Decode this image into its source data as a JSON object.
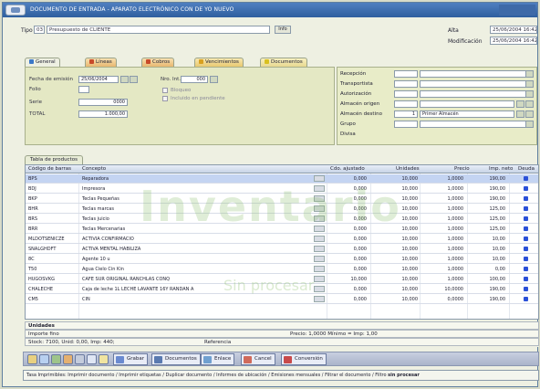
{
  "window": {
    "title": "DOCUMENTO DE ENTRADA - APARATO ELECTRÓNICO CON DE YO NUEVO"
  },
  "header": {
    "tipo_label": "Tipo",
    "tipo_code": "03",
    "tipo_value": "Presupuesto de CLIENTE",
    "info_button": "Info",
    "alta_label": "Alta",
    "alta_value": "25/06/2004 16:42",
    "modificacion_label": "Modificación",
    "modificacion_value": "25/06/2004 16:42"
  },
  "tabs": [
    {
      "label": "General",
      "color": "#3c78c8"
    },
    {
      "label": "Líneas",
      "color": "#c84a2a"
    },
    {
      "label": "Cobros",
      "color": "#c84a2a"
    },
    {
      "label": "Vencimientos",
      "color": "#d8a020"
    },
    {
      "label": "Documentos",
      "color": "#d8c020"
    }
  ],
  "general": {
    "fecha_label": "Fecha de emisión",
    "fecha_value": "25/06/2004",
    "folio_label": "Folio",
    "serie_label": "Serie",
    "serie_value": "0000",
    "total_label": "TOTAL",
    "total_value": "1.000,00",
    "num_label": "Nro. Int.",
    "num_value": "000",
    "check1_label": "Bloqueo",
    "check2_label": "Incluido en pendiente"
  },
  "right_panel": [
    {
      "label": "Recepción",
      "code": "",
      "value": ""
    },
    {
      "label": "Transportista",
      "code": "",
      "value": ""
    },
    {
      "label": "Autorización",
      "code": "",
      "value": ""
    },
    {
      "label": "Almacén origen",
      "code": "",
      "value": ""
    },
    {
      "label": "Almacén destino",
      "code": "1",
      "value": "Primer Almacén"
    },
    {
      "label": "Grupo",
      "code": "",
      "value": ""
    },
    {
      "label": "Divisa",
      "code": "",
      "value": ""
    }
  ],
  "grid": {
    "tab_label": "Tabla de productos",
    "columns": [
      "Código de barras",
      "Concepto",
      "Cdo. ajustado",
      "Unidades",
      "Precio",
      "Imp. neto",
      "Deuda"
    ],
    "rows": [
      {
        "code": "BPS",
        "concept": "Reparadora",
        "cdo": "0,000",
        "units": "10,000",
        "price": "1,0000",
        "neto": "190,00"
      },
      {
        "code": "BDJ",
        "concept": "Impresora",
        "cdo": "0,000",
        "units": "10,000",
        "price": "1,0000",
        "neto": "190,00"
      },
      {
        "code": "BKP",
        "concept": "Teclas Pequeñas",
        "cdo": "0,000",
        "units": "10,000",
        "price": "1,0000",
        "neto": "190,00"
      },
      {
        "code": "BHR",
        "concept": "Teclas marcas",
        "cdo": "0,000",
        "units": "10,000",
        "price": "1,0000",
        "neto": "125,00"
      },
      {
        "code": "BRS",
        "concept": "Teclas juicio",
        "cdo": "0,000",
        "units": "10,000",
        "price": "1,0000",
        "neto": "125,00"
      },
      {
        "code": "BRR",
        "concept": "Teclas Mercenarias",
        "cdo": "0,000",
        "units": "10,000",
        "price": "1,0000",
        "neto": "125,00"
      },
      {
        "code": "MLDOTSENICZE",
        "concept": "ACTIVIA CONFIRMACIÓ",
        "cdo": "0,000",
        "units": "10,000",
        "price": "1,0000",
        "neto": "10,00"
      },
      {
        "code": "SNALGHDFT",
        "concept": "ACTIVA MENTAL HABILIZA",
        "cdo": "0,000",
        "units": "10,000",
        "price": "1,0000",
        "neto": "10,00"
      },
      {
        "code": "8C",
        "concept": "Agente 10 u",
        "cdo": "0,000",
        "units": "10,000",
        "price": "1,0000",
        "neto": "10,00"
      },
      {
        "code": "T50",
        "concept": "Agua Cielo Cin Kin",
        "cdo": "0,000",
        "units": "10,000",
        "price": "1,0000",
        "neto": "0,00"
      },
      {
        "code": "HUGOSVKG",
        "concept": "CAFE SUR ORIGINAL RANCHLAS CONQ",
        "cdo": "10,000",
        "units": "10,000",
        "price": "1,0000",
        "neto": "100,00"
      },
      {
        "code": "CHALECHE",
        "concept": "Caja de leche 1L LECHE LAVANTE 16Y RANDAN A",
        "cdo": "0,000",
        "units": "10,000",
        "price": "10,0000",
        "neto": "190,00"
      },
      {
        "code": "CM5",
        "concept": "CIN",
        "cdo": "0,000",
        "units": "10,000",
        "price": "0,0000",
        "neto": "190,00"
      }
    ]
  },
  "totals": {
    "unidades_label": "Unidades",
    "importe_label": "Importe fino",
    "importe_right": "Precio: 1,0000 Mínimo = Imp: 1,00",
    "stock_label": "Stock: 7100, Unid: 0,00, Imp: 440;",
    "reference_label": "Referencia"
  },
  "toolbar": {
    "buttons": [
      "Grabar",
      "Documentos",
      "Enlace",
      "Cancel",
      "Conversión"
    ]
  },
  "statusbar": {
    "text": "Tasa Imprimibles: Imprimir documento / Imprimir etiquetas / Duplicar documento / Informes de ubicación / Emisiones mensuales / Filtrar el documento / Filtro",
    "bold": "sin procesar"
  },
  "watermark": {
    "main": "Inventario",
    "sub": "Sin procesar"
  }
}
